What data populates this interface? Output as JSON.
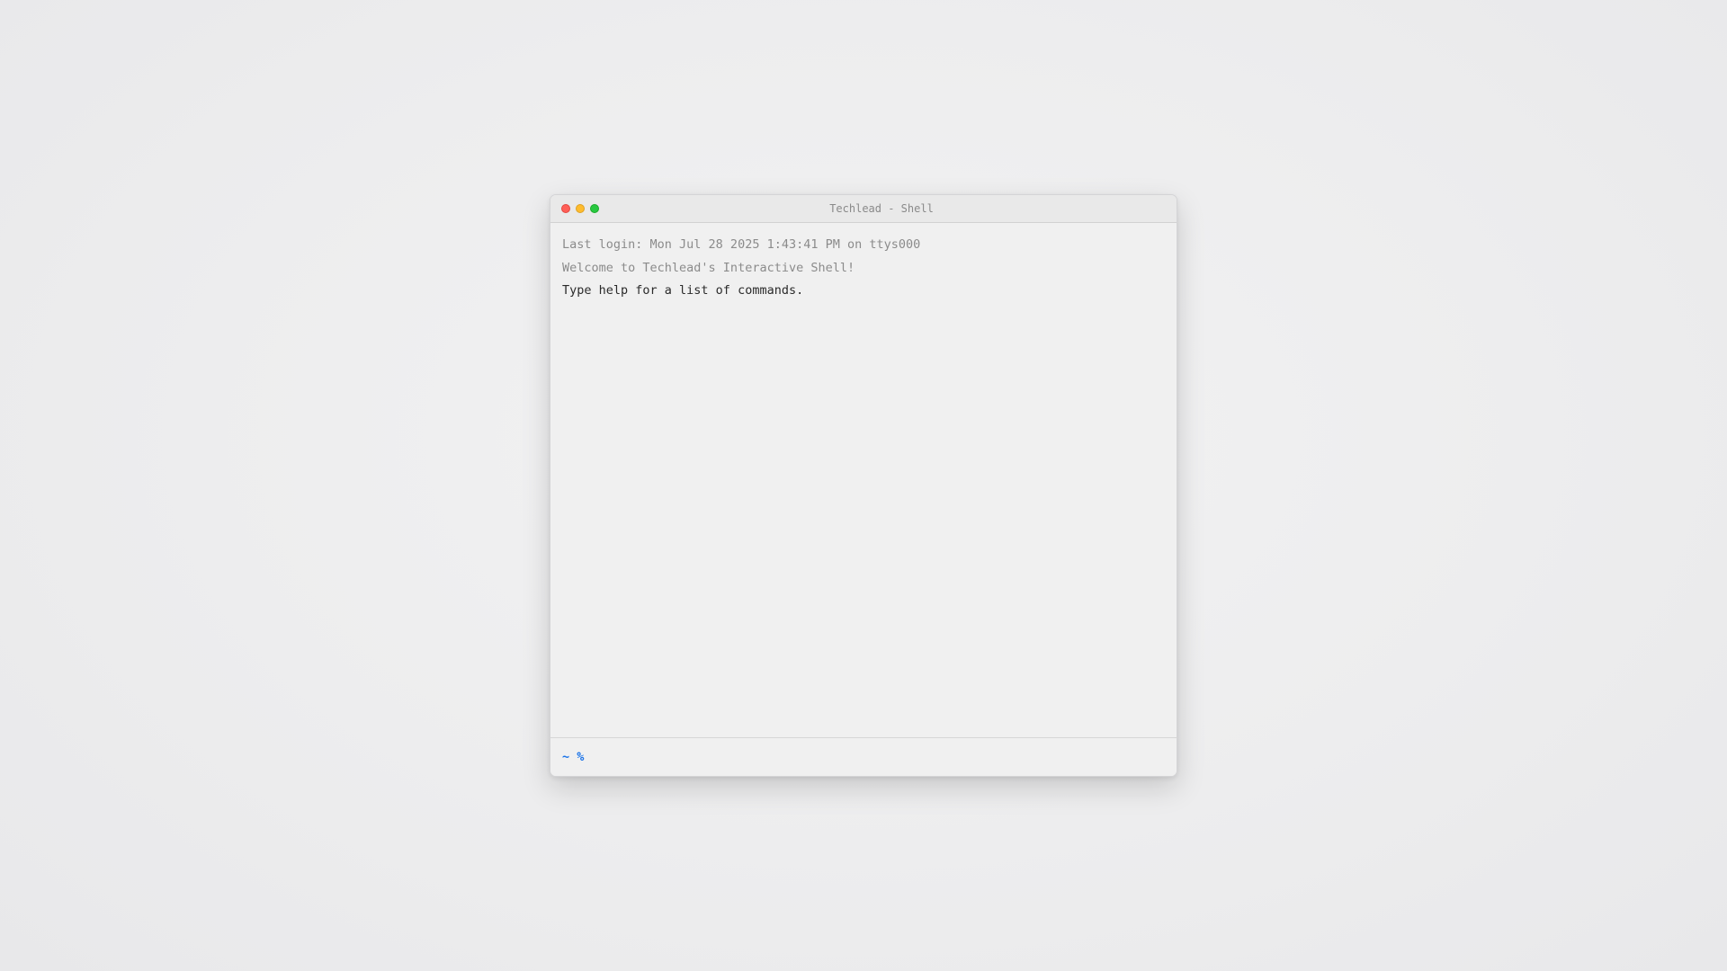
{
  "window": {
    "title": "Techlead - Shell"
  },
  "terminal": {
    "lines": [
      {
        "text": "Last login: Mon Jul 28 2025 1:43:41 PM on ttys000",
        "style": "muted"
      },
      {
        "text": "Welcome to Techlead's Interactive Shell!",
        "style": "muted"
      },
      {
        "text": "Type help for a list of commands.",
        "style": "normal"
      }
    ]
  },
  "prompt": {
    "symbol": "~ %",
    "input_value": "",
    "color": "#1a73e8"
  },
  "colors": {
    "close": "#ff5f57",
    "minimize": "#febc2e",
    "zoom": "#28c840"
  }
}
